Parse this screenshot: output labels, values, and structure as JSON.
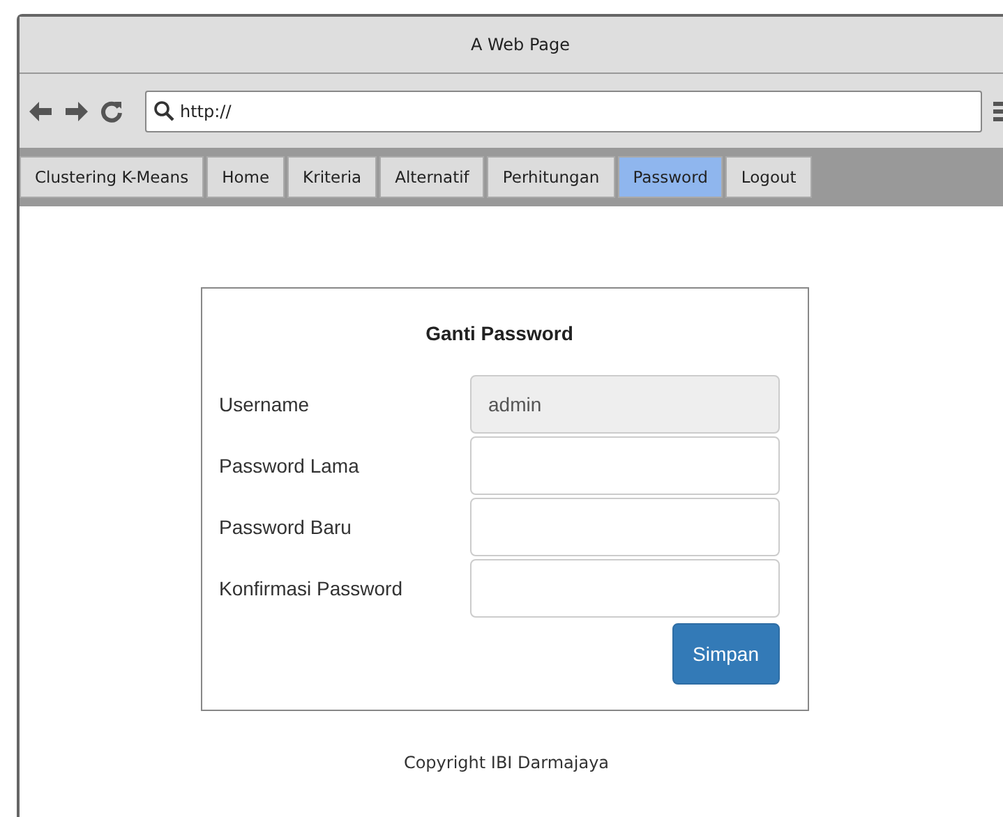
{
  "window": {
    "title": "A Web Page"
  },
  "address_bar": {
    "value": "http://"
  },
  "nav": [
    {
      "label": "Clustering K-Means",
      "selected": false
    },
    {
      "label": "Home",
      "selected": false
    },
    {
      "label": "Kriteria",
      "selected": false
    },
    {
      "label": "Alternatif",
      "selected": false
    },
    {
      "label": "Perhitungan",
      "selected": false
    },
    {
      "label": "Password",
      "selected": true
    },
    {
      "label": "Logout",
      "selected": false
    }
  ],
  "form": {
    "title": "Ganti Password",
    "fields": [
      {
        "label": "Username",
        "value": "admin",
        "disabled": true
      },
      {
        "label": "Password Lama",
        "disabled": false
      },
      {
        "label": "Password Baru",
        "disabled": false
      },
      {
        "label": "Konfirmasi Password",
        "disabled": false
      }
    ],
    "submit": "Simpan"
  },
  "footer": "Copyright IBI Darmajaya"
}
